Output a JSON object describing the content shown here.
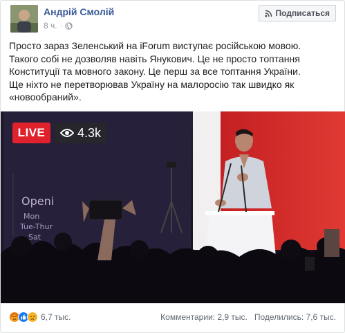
{
  "post": {
    "author": "Андрій Смолій",
    "time": "8 ч.",
    "separator": "·",
    "privacy_icon": "globe-icon",
    "subscribe_label": "Подписаться",
    "text_lines": [
      "Просто зараз Зеленський на iForum виступає російською мовою.",
      "Такого собі не дозволяв навіть Янукович. Це не просто топтання",
      "Конституції та мовного закону. Це перш за все топтання України.",
      "Ще ніхто не перетворював Україну на малоросію так швидко як",
      "«новообраний»."
    ]
  },
  "video": {
    "live_label": "LIVE",
    "viewers": "4.3k",
    "board_text": [
      "Openi",
      "Mon",
      "Tue-Thur",
      "Sat"
    ]
  },
  "footer": {
    "reactions": [
      "angry-icon",
      "like-icon",
      "sad-icon"
    ],
    "reaction_count": "6,7 тыс.",
    "comments": "Комментарии: 2,9 тыс.",
    "shares": "Поделились: 7,6 тыс."
  },
  "colors": {
    "link": "#385898",
    "live": "#e0222c",
    "stage_red": "#d52b2a",
    "muted": "#90949c"
  }
}
